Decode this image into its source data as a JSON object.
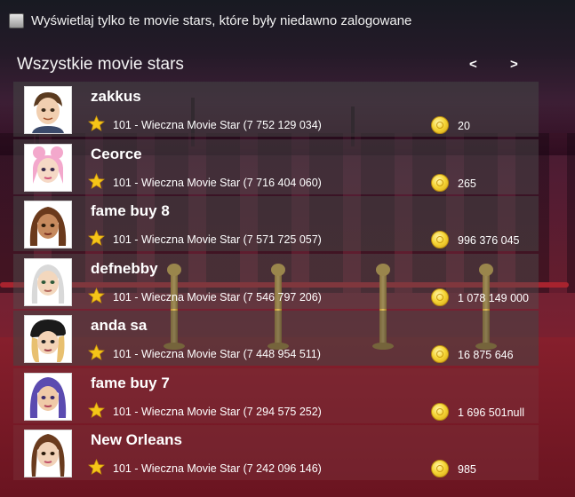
{
  "filter": {
    "label": "Wyświetlaj tylko te movie stars, które były niedawno zalogowane",
    "checked": false
  },
  "section": {
    "title": "Wszystkie movie stars"
  },
  "pagination": {
    "prev_label": "<",
    "next_label": ">"
  },
  "stars": [
    {
      "name": "zakkus",
      "level": "101 - Wieczna Movie Star (7 752 129 034)",
      "amount": "20",
      "hair": "#5a3a1f",
      "skin": "#f1cfb0"
    },
    {
      "name": "Ceorce",
      "level": "101 - Wieczna Movie Star (7 716 404 060)",
      "amount": "265",
      "hair": "#f3a8cc",
      "skin": "#f6d9c6"
    },
    {
      "name": "fame buy 8",
      "level": "101 - Wieczna Movie Star (7 571 725 057)",
      "amount": "996 376 045",
      "hair": "#6b3a1c",
      "skin": "#c68a5e"
    },
    {
      "name": "defnebby",
      "level": "101 - Wieczna Movie Star (7 546 797 206)",
      "amount": "1 078 149 000",
      "hair": "#d9d9d9",
      "skin": "#f3d7bd"
    },
    {
      "name": "anda sa",
      "level": "101 - Wieczna Movie Star (7 448 954 511)",
      "amount": "16 875 646",
      "hair": "#1a1a1a",
      "skin": "#f3d3b6"
    },
    {
      "name": "fame buy 7",
      "level": "101 - Wieczna Movie Star (7 294 575 252)",
      "amount": "1 696 501null",
      "hair": "#5b4bb0",
      "skin": "#f0caa8"
    },
    {
      "name": "New Orleans",
      "level": "101 - Wieczna Movie Star (7 242 096 146)",
      "amount": "985",
      "hair": "#6a3b1e",
      "skin": "#f1d2b8"
    }
  ],
  "icons": {
    "star": "star-icon",
    "coin": "starcoin-icon",
    "checkbox": "checkbox"
  },
  "colors": {
    "row_highlight": "#7a2d37",
    "coin": "#f6d637",
    "star": "#f5c518"
  }
}
